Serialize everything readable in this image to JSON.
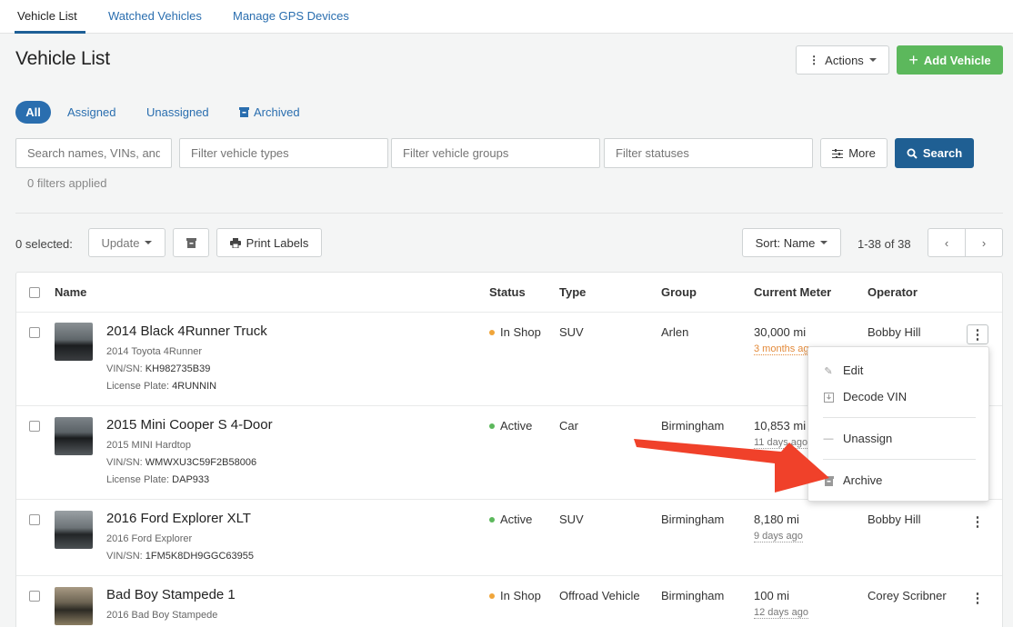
{
  "tabs": [
    "Vehicle List",
    "Watched Vehicles",
    "Manage GPS Devices"
  ],
  "page_title": "Vehicle List",
  "header_buttons": {
    "actions": "Actions",
    "add_vehicle": "Add Vehicle"
  },
  "segments": {
    "all": "All",
    "assigned": "Assigned",
    "unassigned": "Unassigned",
    "archived": "Archived"
  },
  "filters": {
    "search_placeholder": "Search names, VINs, and more",
    "types_placeholder": "Filter vehicle types",
    "groups_placeholder": "Filter vehicle groups",
    "statuses_placeholder": "Filter statuses",
    "more": "More",
    "search": "Search",
    "applied": "0 filters applied"
  },
  "toolbar": {
    "selected": "0 selected:",
    "update": "Update",
    "print_labels": "Print Labels",
    "sort": "Sort: Name",
    "range": "1-38 of 38"
  },
  "columns": [
    "Name",
    "Status",
    "Type",
    "Group",
    "Current Meter",
    "Operator"
  ],
  "rows": [
    {
      "name": "2014 Black 4Runner Truck",
      "model": "2014 Toyota 4Runner",
      "vin_label": "VIN/SN:",
      "vin": "KH982735B39",
      "plate_label": "License Plate:",
      "plate": "4RUNNIN",
      "status": "In Shop",
      "type": "SUV",
      "group": "Arlen",
      "meter": "30,000 mi",
      "meter_age": "3 months ago",
      "operator": "Bobby Hill"
    },
    {
      "name": "2015 Mini Cooper S 4-Door",
      "model": "2015 MINI Hardtop",
      "vin_label": "VIN/SN:",
      "vin": "WMWXU3C59F2B58006",
      "plate_label": "License Plate:",
      "plate": "DAP933",
      "status": "Active",
      "type": "Car",
      "group": "Birmingham",
      "meter": "10,853 mi",
      "meter_age": "11 days ago",
      "operator": ""
    },
    {
      "name": "2016 Ford Explorer XLT",
      "model": "2016 Ford Explorer",
      "vin_label": "VIN/SN:",
      "vin": "1FM5K8DH9GGC63955",
      "status": "Active",
      "type": "SUV",
      "group": "Birmingham",
      "meter": "8,180 mi",
      "meter_age": "9 days ago",
      "operator": "Bobby Hill"
    },
    {
      "name": "Bad Boy Stampede 1",
      "model": "2016 Bad Boy Stampede",
      "status": "In Shop",
      "type": "Offroad Vehicle",
      "group": "Birmingham",
      "meter": "100 mi",
      "meter_age": "12 days ago",
      "operator": "Corey Scribner"
    }
  ],
  "row_menu": [
    "Edit",
    "Decode VIN",
    "Unassign",
    "Archive"
  ],
  "colors": {
    "in_shop": "#f0a53a",
    "active": "#5cb85c",
    "arrow": "#f0412a",
    "primary": "#1f5f93",
    "green": "#5cb85c"
  }
}
